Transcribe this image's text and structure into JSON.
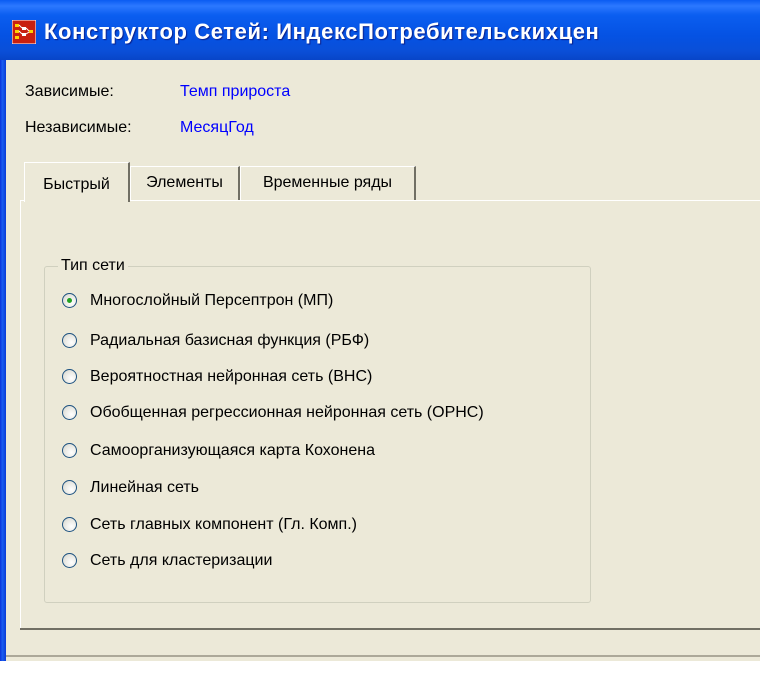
{
  "window": {
    "title": "Конструктор Сетей: ИндексПотребительскихцен",
    "icon": "network-builder-app-icon"
  },
  "info": {
    "dependent_label": "Зависимые:",
    "dependent_value": "Темп прироста",
    "independent_label": "Независимые:",
    "independent_value": "МесяцГод"
  },
  "tabs": [
    {
      "label": "Быстрый",
      "active": true
    },
    {
      "label": "Элементы",
      "active": false
    },
    {
      "label": "Временные ряды",
      "active": false
    }
  ],
  "network_type": {
    "title": "Тип сети",
    "selected_index": 0,
    "options": [
      "Многослойный Персептрон (МП)",
      "Радиальная базисная функция (РБФ)",
      "Вероятностная нейронная сеть (ВНС)",
      "Обобщенная регрессионная нейронная сеть (ОРНС)",
      "Самоорганизующаяся карта Кохонена",
      "Линейная сеть",
      "Сеть главных компонент (Гл. Комп.)",
      "Сеть для кластеризации"
    ]
  },
  "colors": {
    "title_bar": "#0552e3",
    "window_background": "#ece9d8",
    "link_value": "#0000ff",
    "radio_dot": "#21a121"
  }
}
